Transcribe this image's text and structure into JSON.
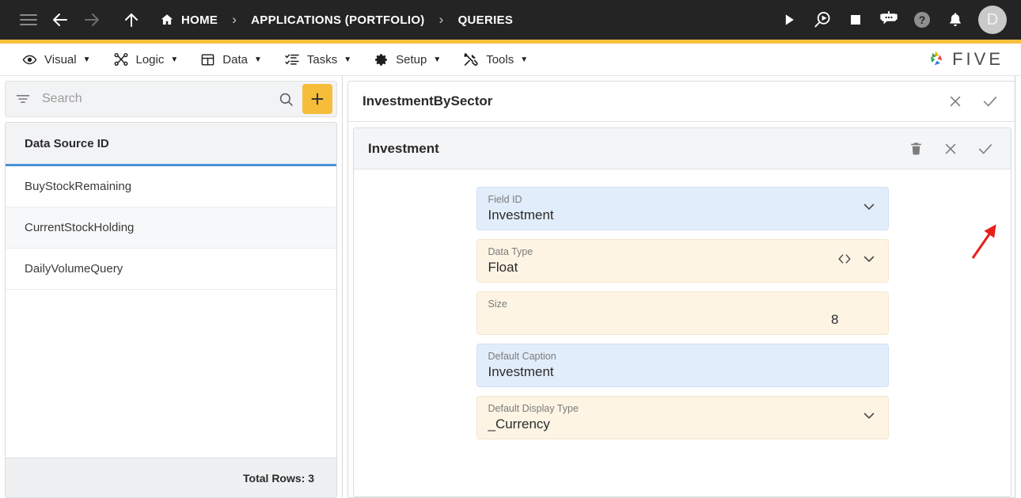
{
  "topbar": {
    "menu_icon": "hamburger-icon",
    "back_icon": "arrow-left-icon",
    "forward_icon": "arrow-right-icon",
    "up_icon": "arrow-up-icon",
    "breadcrumb": [
      {
        "label": "HOME",
        "icon": "home-icon"
      },
      {
        "label": "APPLICATIONS (PORTFOLIO)",
        "icon": ""
      },
      {
        "label": "QUERIES",
        "icon": ""
      }
    ],
    "separator": "›",
    "actions": [
      {
        "name": "run-icon",
        "title": "Run"
      },
      {
        "name": "debug-run-icon",
        "title": "Preview"
      },
      {
        "name": "stop-icon",
        "title": "Stop"
      },
      {
        "name": "bot-icon",
        "title": "Assistant"
      },
      {
        "name": "help-icon",
        "title": "Help"
      },
      {
        "name": "notification-bell-icon",
        "title": "Notifications"
      }
    ],
    "avatar_initial": "D",
    "accent_color": "#f7bf3c"
  },
  "menubar": {
    "items": [
      {
        "label": "Visual",
        "icon": "eye-icon",
        "caret": "▼"
      },
      {
        "label": "Logic",
        "icon": "nodes-icon",
        "caret": "▼"
      },
      {
        "label": "Data",
        "icon": "table-icon",
        "caret": "▼"
      },
      {
        "label": "Tasks",
        "icon": "checklist-icon",
        "caret": "▼"
      },
      {
        "label": "Setup",
        "icon": "gear-icon",
        "caret": "▼"
      },
      {
        "label": "Tools",
        "icon": "tools-icon",
        "caret": "▼"
      }
    ],
    "logo_text": "FIVE"
  },
  "sidebar": {
    "search": {
      "placeholder": "Search",
      "value": ""
    },
    "filter_icon": "filter-icon",
    "search_icon": "search-icon",
    "add_button_label": "+",
    "grid": {
      "column_header": "Data Source ID",
      "rows": [
        "BuyStockRemaining",
        "CurrentStockHolding",
        "DailyVolumeQuery"
      ]
    },
    "footer_total": "Total Rows: 3"
  },
  "record": {
    "outer_title": "InvestmentBySector",
    "outer_actions": [
      {
        "name": "close-icon",
        "glyph": "✕"
      },
      {
        "name": "confirm-check-icon",
        "glyph": "✓"
      }
    ],
    "inner_title": "Investment",
    "inner_actions": [
      {
        "name": "delete-icon",
        "glyph": "trash"
      },
      {
        "name": "close-icon",
        "glyph": "✕"
      },
      {
        "name": "confirm-check-icon",
        "glyph": "✓"
      }
    ],
    "fields": [
      {
        "label": "Field ID",
        "value": "Investment",
        "style": "blue",
        "align": "left",
        "icons": [
          "chevron-down-icon"
        ]
      },
      {
        "label": "Data Type",
        "value": "Float",
        "style": "cream",
        "align": "left",
        "icons": [
          "code-brackets-icon",
          "chevron-down-icon"
        ]
      },
      {
        "label": "Size",
        "value": "8",
        "style": "cream",
        "align": "right",
        "icons": []
      },
      {
        "label": "Default Caption",
        "value": "Investment",
        "style": "blue",
        "align": "left",
        "icons": []
      },
      {
        "label": "Default Display Type",
        "value": "_Currency",
        "style": "cream",
        "align": "left",
        "icons": [
          "chevron-down-icon"
        ]
      }
    ]
  },
  "annotation": {
    "arrow_color": "#e8201a",
    "points_to": "confirm-check-icon"
  },
  "colors": {
    "topbar_bg": "#242424",
    "accent": "#f7bf3c",
    "field_blue": "#e2edfb",
    "field_cream": "#fdf4e4",
    "header_underline": "#4a90d9"
  }
}
